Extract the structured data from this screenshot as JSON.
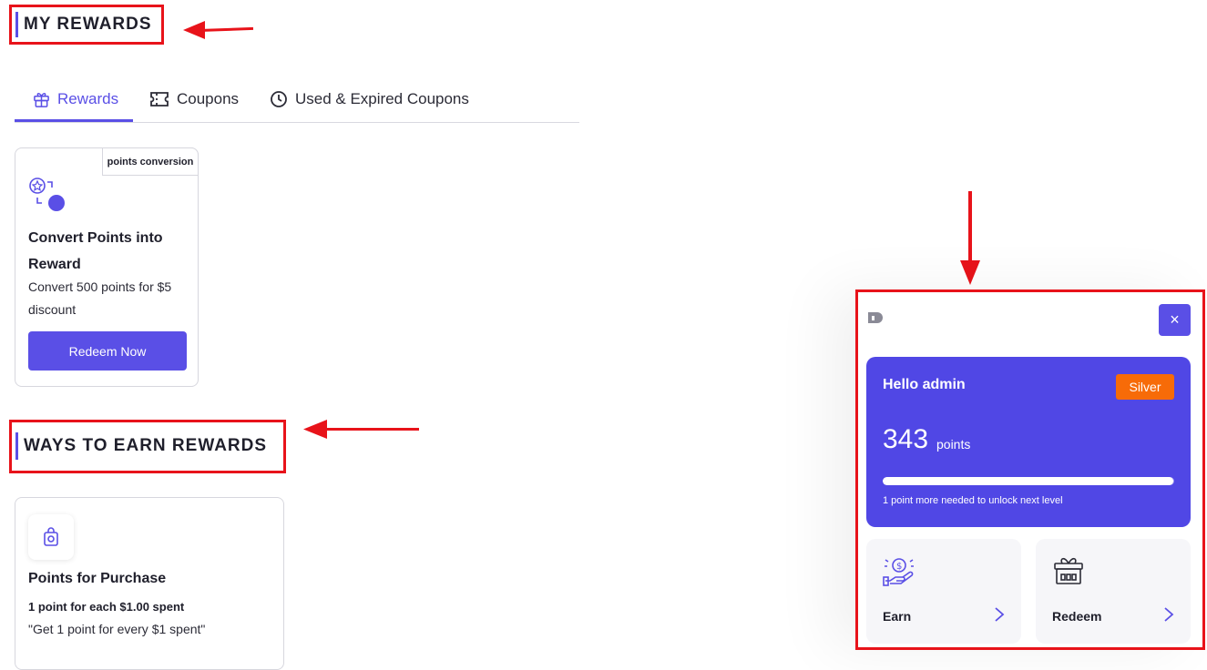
{
  "sections": {
    "my_rewards": "MY REWARDS",
    "ways_to_earn": "WAYS TO EARN REWARDS"
  },
  "tabs": [
    {
      "label": "Rewards",
      "icon": "gift-box-icon",
      "active": true
    },
    {
      "label": "Coupons",
      "icon": "ticket-icon",
      "active": false
    },
    {
      "label": "Used & Expired Coupons",
      "icon": "clock-icon",
      "active": false
    }
  ],
  "reward_card": {
    "badge": "points conversion",
    "title": "Convert Points into Reward",
    "description": "Convert 500 points for $5 discount",
    "button": "Redeem Now",
    "icon": "points-conversion-icon"
  },
  "earn_card": {
    "icon": "shopping-bag-icon",
    "title": "Points for Purchase",
    "subtitle": "1 point for each $1.00 spent",
    "quote": "\"Get 1 point for every $1 spent\""
  },
  "widget": {
    "greeting": "Hello admin",
    "tier": "Silver",
    "points": "343",
    "points_label": "points",
    "progress_fraction": 0.997,
    "level_note": "1 point more needed to unlock next level",
    "close": "×",
    "actions": [
      {
        "label": "Earn",
        "icon": "hand-coin-icon"
      },
      {
        "label": "Redeem",
        "icon": "gift-redeem-icon"
      }
    ]
  },
  "colors": {
    "accent": "#5a4fe6",
    "widget_card": "#5047e5",
    "tier_badge": "#f76b08",
    "annotation_red": "#e8131a"
  }
}
